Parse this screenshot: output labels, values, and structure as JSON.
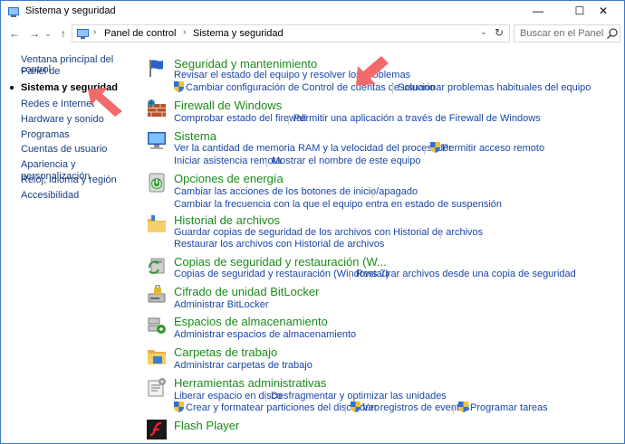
{
  "window": {
    "title": "Sistema y seguridad",
    "controls": {
      "minimize": "—",
      "maximize": "☐",
      "close": "✕"
    }
  },
  "navigation": {
    "back": "←",
    "forward": "→",
    "history": "⌄",
    "up": "↑",
    "breadcrumb": [
      "Panel de control",
      "Sistema y seguridad"
    ],
    "breadcrumb_separator": "›",
    "search_placeholder": "Buscar en el Panel de c..."
  },
  "sidebar": {
    "items": [
      {
        "label": "Ventana principal del Panel de",
        "label2": "control",
        "active": false
      },
      {
        "label": "Sistema y seguridad",
        "active": true
      },
      {
        "label": "Redes e Internet",
        "active": false
      },
      {
        "label": "Hardware y sonido",
        "active": false
      },
      {
        "label": "Programas",
        "active": false
      },
      {
        "label": "Cuentas de usuario",
        "active": false
      },
      {
        "label": "Apariencia y personalización",
        "active": false
      },
      {
        "label": "Reloj, idioma y región",
        "active": false
      },
      {
        "label": "Accesibilidad",
        "active": false
      }
    ]
  },
  "categories": {
    "seguridad": {
      "title": "Seguridad y mantenimiento",
      "links": [
        "Revisar el estado del equipo y resolver los problemas",
        "Cambiar configuración de Control de cuentas de usuario",
        "Solucionar problemas habituales del equipo"
      ]
    },
    "firewall": {
      "title": "Firewall de Windows",
      "links": [
        "Comprobar estado del firewall",
        "Permitir una aplicación a través de Firewall de Windows"
      ]
    },
    "sistema": {
      "title": "Sistema",
      "links": [
        "Ver la cantidad de memoria RAM y la velocidad del procesador",
        "Permitir acceso remoto",
        "Iniciar asistencia remota",
        "Mostrar el nombre de este equipo"
      ]
    },
    "energia": {
      "title": "Opciones de energía",
      "links": [
        "Cambiar las acciones de los botones de inicio/apagado",
        "Cambiar la frecuencia con la que el equipo entra en estado de suspensión"
      ]
    },
    "historial": {
      "title": "Historial de archivos",
      "links": [
        "Guardar copias de seguridad de los archivos con Historial de archivos",
        "Restaurar los archivos con Historial de archivos"
      ]
    },
    "copias": {
      "title": "Copias de seguridad y restauración (W...",
      "links": [
        "Copias de seguridad y restauración (Windows 7)",
        "Restaurar archivos desde una copia de seguridad"
      ]
    },
    "bitlocker": {
      "title": "Cifrado de unidad BitLocker",
      "links": [
        "Administrar BitLocker"
      ]
    },
    "espacios": {
      "title": "Espacios de almacenamiento",
      "links": [
        "Administrar espacios de almacenamiento"
      ]
    },
    "carpetas": {
      "title": "Carpetas de trabajo",
      "links": [
        "Administrar carpetas de trabajo"
      ]
    },
    "herramientas": {
      "title": "Herramientas administrativas",
      "links": [
        "Liberar espacio en disco",
        "Desfragmentar y optimizar las unidades",
        "Crear y formatear particiones del disco duro",
        "Ver registros de eventos",
        "Programar tareas"
      ]
    },
    "flash": {
      "title": "Flash Player",
      "links": []
    }
  },
  "colors": {
    "category_title": "#1b8a1b",
    "link": "#1a46a8",
    "annotation_arrow": "#f26a6a"
  }
}
